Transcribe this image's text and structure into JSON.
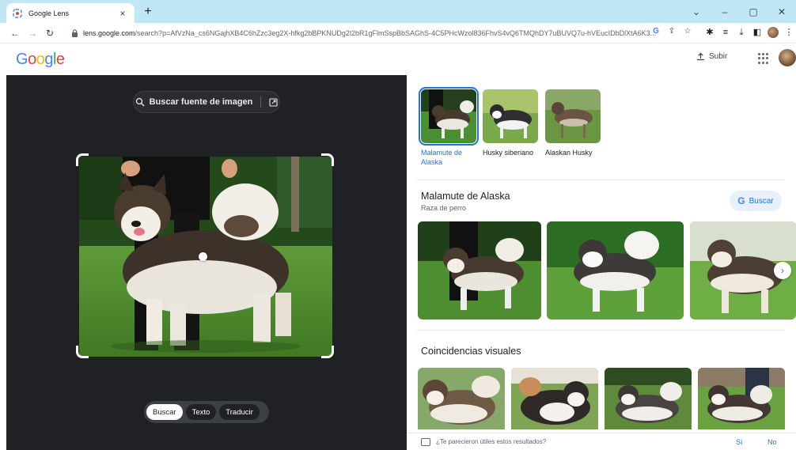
{
  "browser": {
    "tab_title": "Google Lens",
    "tab_close": "×",
    "new_tab": "+",
    "url_domain": "lens.google.com",
    "url_path": "/search?p=AfVzNa_cs6NGajhXB4C6hZzc3eg2X-hfkg2bBPKNUDg2l2bR1gFlmSspBbSAGhS-4C5PHcWzol836FhvS4vQ6TMQhDY7uBUVQ7u-hVEucIDbDlXtA6K3...",
    "win_minimize": "–",
    "win_restore": "▢",
    "win_close": "✕",
    "win_dropdown": "⌄"
  },
  "header": {
    "logo": [
      "G",
      "o",
      "o",
      "g",
      "l",
      "e"
    ],
    "upload_label": "Subir"
  },
  "left": {
    "source_button_label": "Buscar fuente de imagen",
    "modes": [
      {
        "label": "Buscar",
        "active": true
      },
      {
        "label": "Texto",
        "active": false
      },
      {
        "label": "Traducir",
        "active": false
      }
    ]
  },
  "suggestions": [
    {
      "label": "Malamute de Alaska",
      "active": true
    },
    {
      "label": "Husky siberiano",
      "active": false
    },
    {
      "label": "Alaskan Husky",
      "active": false
    }
  ],
  "knowledge": {
    "title": "Malamute de Alaska",
    "subtitle": "Raza de perro",
    "search_label": "Buscar",
    "search_g": "G"
  },
  "visual_matches": {
    "title": "Coincidencias visuales"
  },
  "feedback": {
    "question": "¿Te parecieron útiles estos resultados?",
    "yes": "Sí",
    "no": "No"
  },
  "colors": {
    "accent": "#1a73e8",
    "dark_pane": "#202124",
    "tabstrip": "#bfe7f5"
  }
}
